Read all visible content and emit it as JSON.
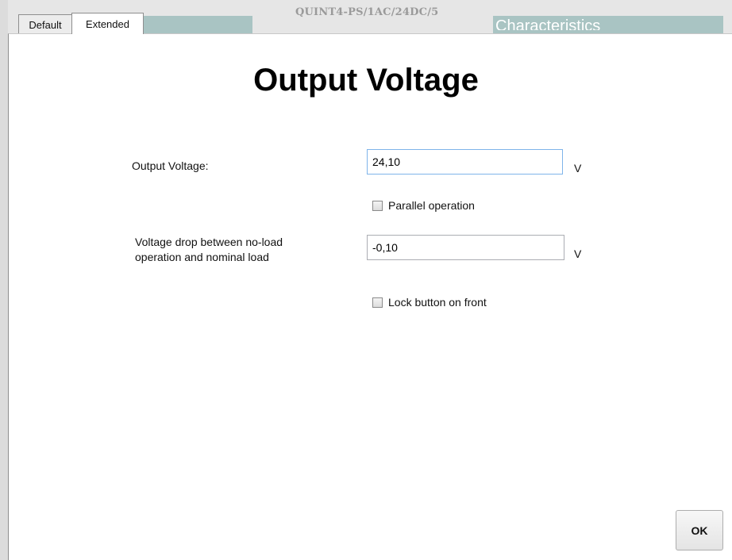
{
  "background": {
    "product_title": "QUINT4-PS/1AC/24DC/5",
    "characteristics_label": "Characteristics"
  },
  "tabs": [
    {
      "label": "Default",
      "active": false
    },
    {
      "label": "Extended",
      "active": true
    }
  ],
  "dialog": {
    "heading": "Output Voltage",
    "output_voltage": {
      "label": "Output Voltage:",
      "value": "24,10",
      "unit": "V"
    },
    "parallel_operation": {
      "label": "Parallel operation",
      "checked": false
    },
    "voltage_drop": {
      "label_line1": "Voltage drop between no-load",
      "label_line2": "operation and nominal load",
      "value": "-0,10",
      "unit": "V"
    },
    "lock_button": {
      "label": "Lock button on front",
      "checked": false
    },
    "ok_label": "OK"
  },
  "colors": {
    "background_strip": "#a9c4c3",
    "input_focus_border": "#7eb4ea"
  }
}
